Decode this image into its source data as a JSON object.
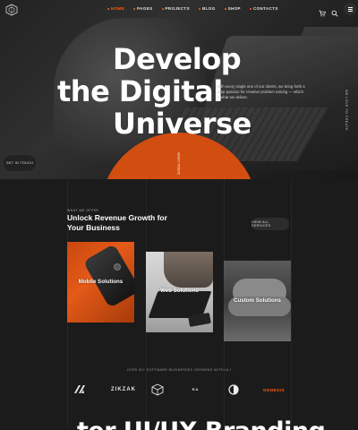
{
  "nav": {
    "items": [
      {
        "label": "HOME",
        "active": true
      },
      {
        "label": "PAGES",
        "active": false
      },
      {
        "label": "PROJECTS",
        "active": false
      },
      {
        "label": "BLOG",
        "active": false
      },
      {
        "label": "SHOP",
        "active": false
      },
      {
        "label": "CONTACTS",
        "active": false
      }
    ],
    "icons": [
      "logo-icon",
      "cart-icon",
      "search-icon",
      "menu-icon"
    ]
  },
  "hero": {
    "line1": "Develop",
    "line2": "the Digital",
    "line3": "Universe",
    "description": "With every single one of our clients, we bring forth a deep passion for creative problem solving — which is what we deliver.",
    "cta": "GET IN TOUCH",
    "vertical_right": "WE LOVE TO CREATE",
    "vertical_mid": "SCROLL DOWN"
  },
  "services": {
    "eyebrow": "WHAT WE OFFER",
    "title": "Unlock Revenue Growth for Your Business",
    "view_all": "VIEW ALL SERVICES",
    "cards": [
      {
        "label": "Mobile Solutions"
      },
      {
        "label": "Web Solutions"
      },
      {
        "label": "Custom Solutions"
      }
    ]
  },
  "clients": {
    "caption": "OVER 50+ SOFTWARE BUSINESSES GROWING WITH ULI",
    "brands": [
      "ZIKZAK",
      "R A",
      "GENESIS"
    ]
  },
  "bottom": {
    "text": "ter UI/UX   Branding"
  },
  "colors": {
    "accent": "#ff5e14",
    "background": "#1b1b1b"
  }
}
